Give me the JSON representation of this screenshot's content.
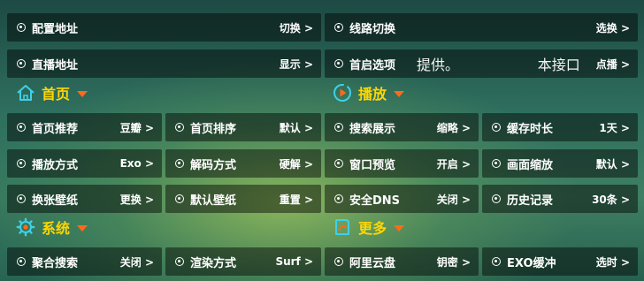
{
  "top_rows": [
    {
      "label": "配置地址",
      "value": "切换 >"
    },
    {
      "label": "线路切换",
      "value": "选换 >"
    },
    {
      "label": "直播地址",
      "value": "显示 >"
    },
    {
      "label": "首启选项",
      "inline_text_1": "提供。",
      "inline_text_2": "本接口",
      "value": "点播 >"
    }
  ],
  "sections": {
    "home": {
      "title": "首页",
      "icon": "home-icon"
    },
    "play": {
      "title": "播放",
      "icon": "play-icon"
    },
    "system": {
      "title": "系统",
      "icon": "gear-icon"
    },
    "more": {
      "title": "更多",
      "icon": "note-icon"
    }
  },
  "home_items": [
    {
      "label": "首页推荐",
      "value": "豆瓣 >"
    },
    {
      "label": "首页排序",
      "value": "默认 >"
    },
    {
      "label": "播放方式",
      "value": "Exo >"
    },
    {
      "label": "解码方式",
      "value": "硬解 >"
    },
    {
      "label": "换张壁纸",
      "value": "更换 >"
    },
    {
      "label": "默认壁纸",
      "value": "重置 >"
    }
  ],
  "play_items": [
    {
      "label": "搜索展示",
      "value": "缩略 >"
    },
    {
      "label": "缓存时长",
      "value": "1天 >"
    },
    {
      "label": "窗口预览",
      "value": "开启 >"
    },
    {
      "label": "画面缩放",
      "value": "默认 >"
    },
    {
      "label": "安全DNS",
      "value": "关闭 >"
    },
    {
      "label": "历史记录",
      "value": "30条 >"
    }
  ],
  "system_items": [
    {
      "label": "聚合搜索",
      "value": "关闭 >"
    },
    {
      "label": "渲染方式",
      "value": "Surf >"
    }
  ],
  "more_items": [
    {
      "label": "阿里云盘",
      "value": "钥密 >"
    },
    {
      "label": "EXO缓冲",
      "value": "选时 >"
    }
  ],
  "colors": {
    "section_title": "#ffd700",
    "section_icon": "#3fd0e8",
    "caret": "#ff6a1a",
    "tile_bg": "rgba(0,0,0,0.45)"
  }
}
